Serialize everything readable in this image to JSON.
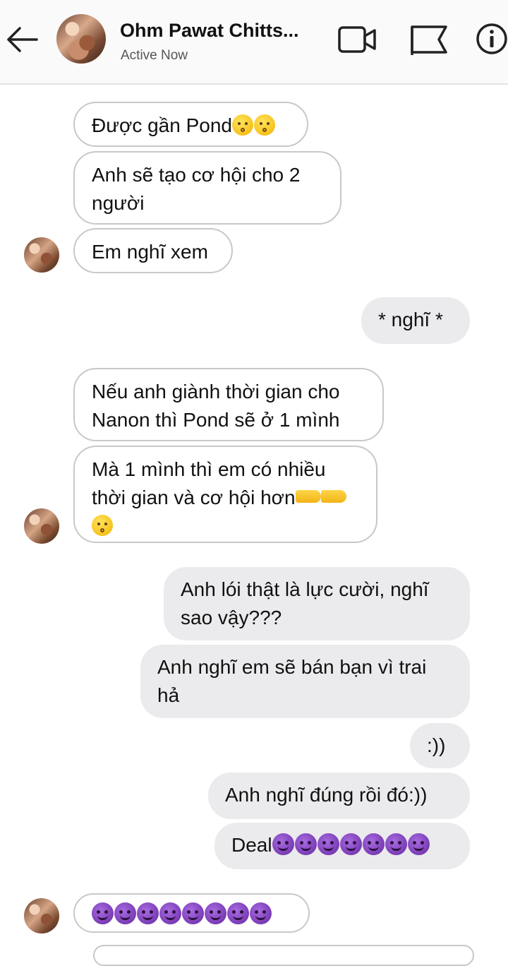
{
  "header": {
    "title": "Ohm Pawat Chitts...",
    "status": "Active Now",
    "icons": [
      "back-arrow-icon",
      "video-call-icon",
      "flag-icon",
      "info-icon"
    ]
  },
  "messages": [
    {
      "side": "received",
      "text": "Được gần Pond",
      "emoji": [
        "kissing-face",
        "kissing-face"
      ]
    },
    {
      "side": "received",
      "text": "Anh sẽ tạo cơ hội cho 2\nngười"
    },
    {
      "side": "received",
      "text": "Em nghĩ xem",
      "avatar": true
    },
    {
      "side": "sent",
      "text": "* nghĩ *"
    },
    {
      "side": "received",
      "text": "Nếu anh giành thời gian cho\nNanon thì Pond sẽ ở 1 mình"
    },
    {
      "side": "received",
      "text": "Mà 1 mình thì em có nhiều\nthời gian và cơ hội hơn",
      "emoji": [
        "pointing-right",
        "pointing-left",
        "kissing-face"
      ],
      "avatar": true
    },
    {
      "side": "sent",
      "text": "Anh lói thật là lực cười, nghĩ\nsao vậy???"
    },
    {
      "side": "sent",
      "text": "Anh nghĩ em sẽ bán bạn vì trai\nhả"
    },
    {
      "side": "sent",
      "text": ":))"
    },
    {
      "side": "sent",
      "text": "Anh nghĩ đúng rồi đó:))"
    },
    {
      "side": "sent",
      "text": "Deal",
      "emoji": [
        "smiling-devil",
        "smiling-devil",
        "smiling-devil",
        "smiling-devil",
        "smiling-devil",
        "smiling-devil",
        "smiling-devil"
      ]
    },
    {
      "side": "received",
      "text": "",
      "emoji": [
        "smiling-devil",
        "smiling-devil",
        "smiling-devil",
        "smiling-devil",
        "smiling-devil",
        "smiling-devil",
        "smiling-devil",
        "smiling-devil"
      ],
      "avatar": true
    }
  ],
  "colors": {
    "sent_bubble": "#ebebed",
    "received_border": "#c8c8c8",
    "header_bg": "#fafafa"
  }
}
